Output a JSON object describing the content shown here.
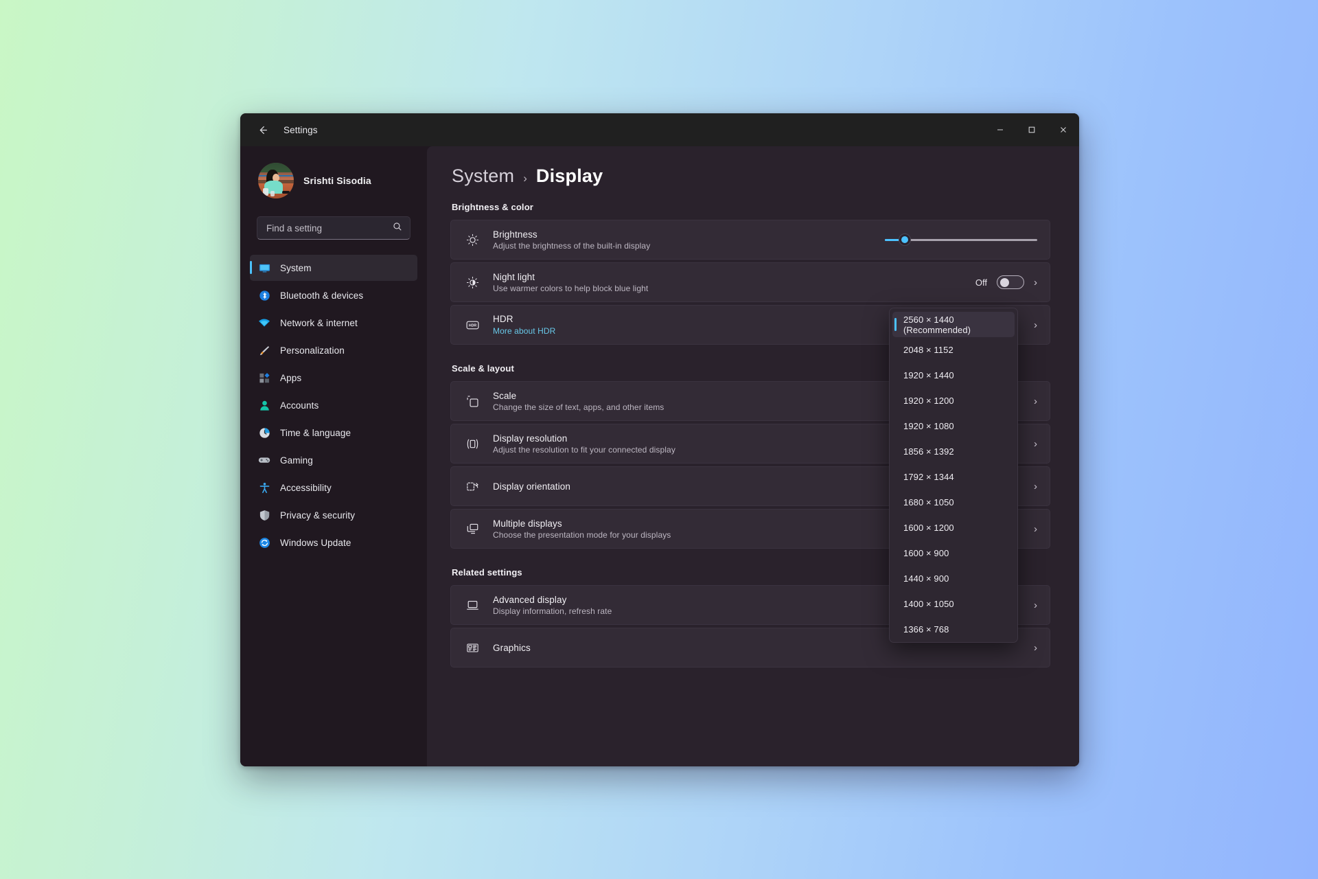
{
  "window": {
    "title": "Settings",
    "back_icon": "arrow-left-icon",
    "controls": {
      "minimize": "–",
      "maximize": "□",
      "close": "✕"
    }
  },
  "sidebar": {
    "account": {
      "name": "Srishti Sisodia",
      "avatar": "user-avatar"
    },
    "search": {
      "placeholder": "Find a setting",
      "value": "",
      "icon": "search-icon"
    },
    "items": [
      {
        "label": "System",
        "icon": "monitor-icon",
        "active": true
      },
      {
        "label": "Bluetooth & devices",
        "icon": "bluetooth-icon",
        "active": false
      },
      {
        "label": "Network & internet",
        "icon": "wifi-icon",
        "active": false
      },
      {
        "label": "Personalization",
        "icon": "paintbrush-icon",
        "active": false
      },
      {
        "label": "Apps",
        "icon": "apps-icon",
        "active": false
      },
      {
        "label": "Accounts",
        "icon": "person-icon",
        "active": false
      },
      {
        "label": "Time & language",
        "icon": "clock-icon",
        "active": false
      },
      {
        "label": "Gaming",
        "icon": "gamepad-icon",
        "active": false
      },
      {
        "label": "Accessibility",
        "icon": "accessibility-icon",
        "active": false
      },
      {
        "label": "Privacy & security",
        "icon": "shield-icon",
        "active": false
      },
      {
        "label": "Windows Update",
        "icon": "update-icon",
        "active": false
      }
    ]
  },
  "breadcrumb": {
    "parent": "System",
    "separator": "›",
    "current": "Display"
  },
  "sections": {
    "brightness_color": {
      "heading": "Brightness & color",
      "rows": [
        {
          "title": "Brightness",
          "subtitle": "Adjust the brightness of the built-in display",
          "icon": "sun-icon",
          "control": "slider",
          "slider_percent": 13
        },
        {
          "title": "Night light",
          "subtitle": "Use warmer colors to help block blue light",
          "icon": "night-light-icon",
          "control": "toggle",
          "toggle_state": "Off",
          "chevron": "›"
        },
        {
          "title": "HDR",
          "link": "More about HDR",
          "icon": "hdr-icon",
          "control": "chevron",
          "chevron": "›"
        }
      ]
    },
    "scale_layout": {
      "heading": "Scale & layout",
      "rows": [
        {
          "title": "Scale",
          "subtitle": "Change the size of text, apps, and other items",
          "icon": "scale-icon",
          "chevron": "›"
        },
        {
          "title": "Display resolution",
          "subtitle": "Adjust the resolution to fit your connected display",
          "icon": "resolution-icon",
          "chevron": "›"
        },
        {
          "title": "Display orientation",
          "subtitle": "",
          "icon": "orientation-icon",
          "chevron": "›"
        },
        {
          "title": "Multiple displays",
          "subtitle": "Choose the presentation mode for your displays",
          "icon": "multiple-displays-icon",
          "chevron": "›"
        }
      ]
    },
    "related_settings": {
      "heading": "Related settings",
      "rows": [
        {
          "title": "Advanced display",
          "subtitle": "Display information, refresh rate",
          "icon": "advanced-display-icon",
          "chevron": "›"
        },
        {
          "title": "Graphics",
          "subtitle": "",
          "icon": "graphics-icon",
          "chevron": "›"
        }
      ]
    }
  },
  "resolution_dropdown": {
    "open": true,
    "selected_index": 0,
    "options": [
      "2560 × 1440 (Recommended)",
      "2048 × 1152",
      "1920 × 1440",
      "1920 × 1200",
      "1920 × 1080",
      "1856 × 1392",
      "1792 × 1344",
      "1680 × 1050",
      "1600 × 1200",
      "1600 × 900",
      "1440 × 900",
      "1400 × 1050",
      "1366 × 768"
    ]
  },
  "colors": {
    "accent": "#4cc2ff",
    "link": "#68c8e8",
    "window_bg": "#201820",
    "main_bg": "#2a222c",
    "card_bg": "#332b36",
    "bg_gradient_start": "#c9f7c5",
    "bg_gradient_end": "#92b4fd"
  }
}
